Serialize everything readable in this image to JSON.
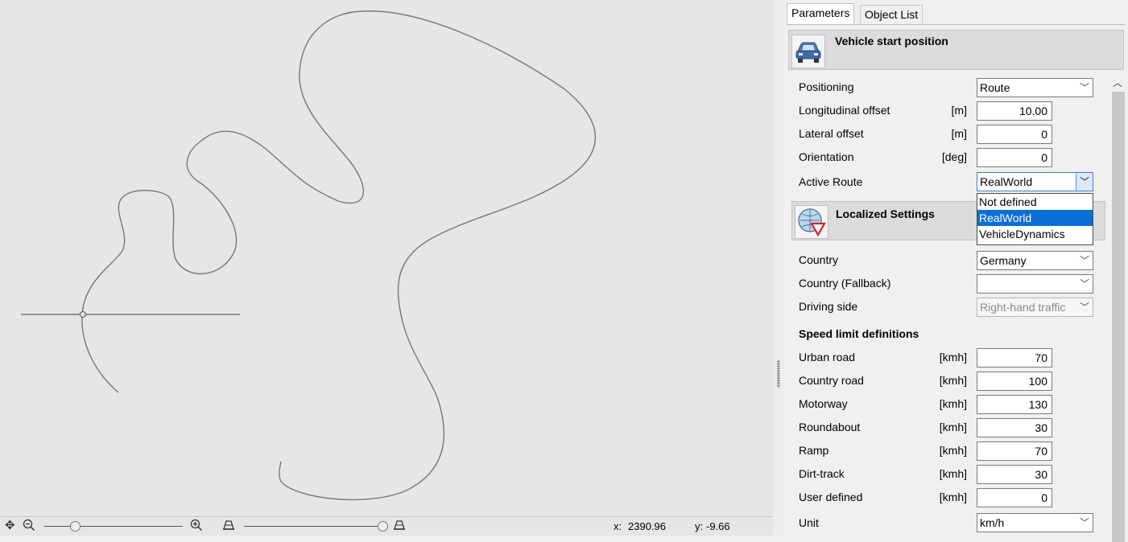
{
  "canvas": {
    "toolbar": {
      "pan_icon": "pan-icon",
      "zoom_out_icon": "zoom-out-icon",
      "zoom_in_icon": "zoom-in-icon",
      "perspective_icon": "perspective-icon",
      "zoom_slider_value": 0.2,
      "perspective_slider_value": 1.0
    },
    "coords": {
      "x_label": "x:",
      "x_value": "2390.96",
      "y_label": "y:",
      "y_value": "-9.66"
    }
  },
  "panel": {
    "tabs": [
      {
        "label": "Parameters",
        "active": true
      },
      {
        "label": "Object List",
        "active": false
      }
    ],
    "vehicle_section": {
      "title": "Vehicle start position",
      "icon": "car-icon",
      "rows": {
        "positioning": {
          "label": "Positioning",
          "value": "Route"
        },
        "long_offset": {
          "label": "Longitudinal offset",
          "unit": "[m]",
          "value": "10.00"
        },
        "lat_offset": {
          "label": "Lateral offset",
          "unit": "[m]",
          "value": "0"
        },
        "orientation": {
          "label": "Orientation",
          "unit": "[deg]",
          "value": "0"
        },
        "active_route": {
          "label": "Active Route",
          "value": "RealWorld"
        }
      },
      "route_options": [
        "Not defined",
        "RealWorld",
        "VehicleDynamics"
      ],
      "route_selected_index": 1
    },
    "localized_section": {
      "title": "Localized Settings",
      "icon": "globe-sign-icon",
      "rows": {
        "country": {
          "label": "Country",
          "value": "Germany"
        },
        "country_fallback": {
          "label": "Country (Fallback)",
          "value": ""
        },
        "driving_side": {
          "label": "Driving side",
          "value": "Right-hand traffic"
        }
      },
      "speed_heading": "Speed limit definitions",
      "speed_unit": "[kmh]",
      "speed_limits": [
        {
          "label": "Urban road",
          "value": "70"
        },
        {
          "label": "Country road",
          "value": "100"
        },
        {
          "label": "Motorway",
          "value": "130"
        },
        {
          "label": "Roundabout",
          "value": "30"
        },
        {
          "label": "Ramp",
          "value": "70"
        },
        {
          "label": "Dirt-track",
          "value": "30"
        },
        {
          "label": "User defined",
          "value": "0"
        }
      ],
      "unit_row": {
        "label": "Unit",
        "value": "km/h"
      }
    }
  },
  "colors": {
    "road": "#777777",
    "selection": "#0a6fd6",
    "canvas_bg": "#e6e6e6"
  }
}
